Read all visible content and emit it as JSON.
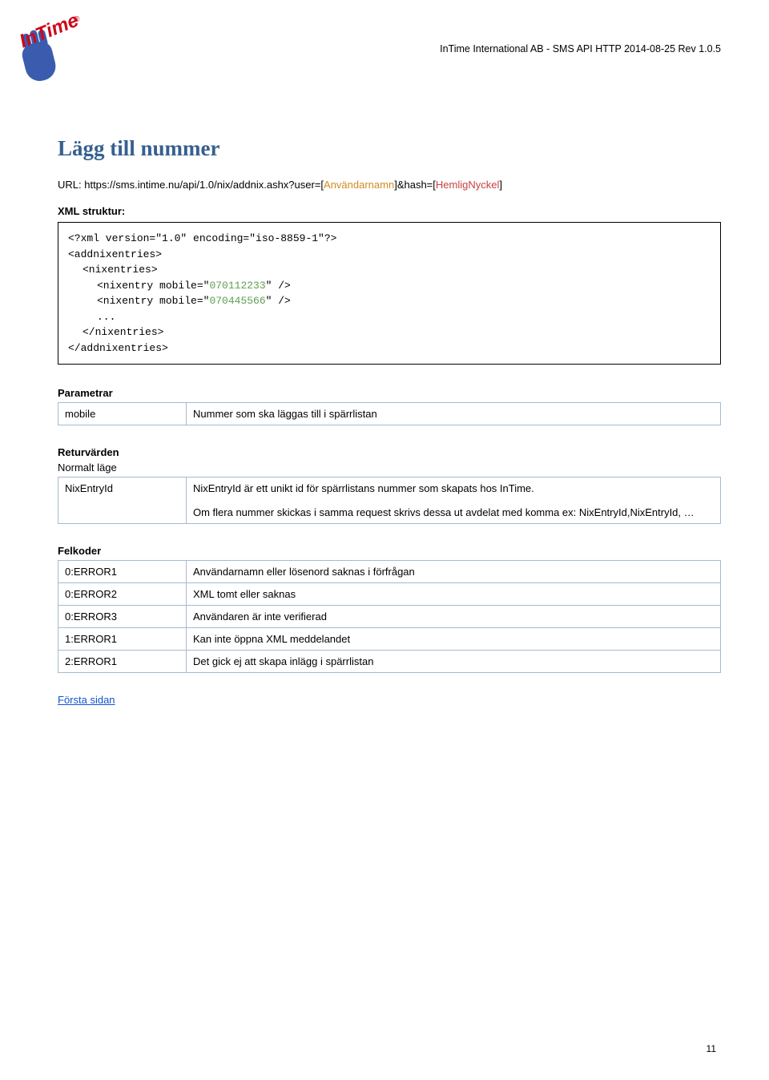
{
  "logo": {
    "brand": "InTime",
    "reg": "®"
  },
  "header": "InTime International AB - SMS API HTTP 2014-08-25 Rev 1.0.5",
  "title": "Lägg till nummer",
  "url": {
    "prefix": "URL: https://sms.intime.nu/api/1.0/nix/addnix.ashx?user=[",
    "user": "Användarnamn",
    "mid": "]&hash=[",
    "hash": "HemligNyckel",
    "suffix": "]"
  },
  "xml_label": "XML struktur:",
  "code": {
    "l1": "<?xml version=\"1.0\" encoding=\"iso-8859-1\"?>",
    "l2": "<addnixentries>",
    "l3": "<nixentries>",
    "l4a": "<nixentry mobile=\"",
    "l4b": "\" />",
    "v1": "070112233",
    "l5a": "<nixentry mobile=\"",
    "l5b": "\" />",
    "v2": "070445566",
    "l6": "...",
    "l7": "</nixentries>",
    "l8": "</addnixentries>"
  },
  "parametrar": {
    "title": "Parametrar",
    "rows": [
      {
        "name": "mobile",
        "desc": "Nummer som ska läggas till i spärrlistan"
      }
    ]
  },
  "returvarden": {
    "title": "Returvärden",
    "subtitle": "Normalt läge",
    "rows": [
      {
        "name": "NixEntryId",
        "desc1": "NixEntryId är ett unikt id för spärrlistans nummer som skapats  hos InTime.",
        "desc2": "Om flera nummer skickas i samma request skrivs dessa ut avdelat med komma ex: NixEntryId,NixEntryId, …"
      }
    ]
  },
  "felkoder": {
    "title": "Felkoder",
    "rows": [
      {
        "name": "0:ERROR1",
        "desc": "Användarnamn eller lösenord saknas i förfrågan"
      },
      {
        "name": "0:ERROR2",
        "desc": "XML tomt eller saknas"
      },
      {
        "name": "0:ERROR3",
        "desc": "Användaren är inte verifierad"
      },
      {
        "name": "1:ERROR1",
        "desc": "Kan inte öppna XML meddelandet"
      },
      {
        "name": "2:ERROR1",
        "desc": "Det gick ej att skapa inlägg i spärrlistan"
      }
    ]
  },
  "firstpage": "Första sidan",
  "pagenum": "11"
}
